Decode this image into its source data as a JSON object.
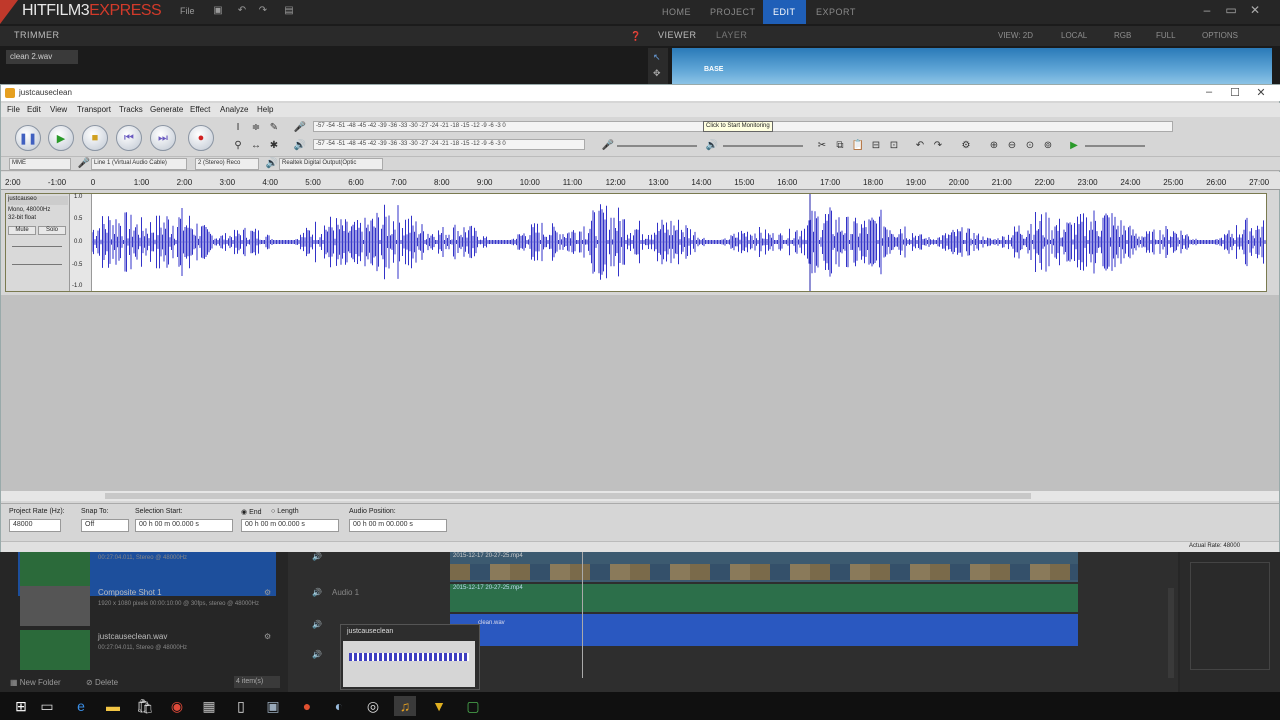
{
  "hitfilm": {
    "logo_main": "HITFILM3",
    "logo_accent": "EXPRESS",
    "menu_file": "File",
    "nav": [
      "HOME",
      "PROJECT",
      "EDIT",
      "EXPORT"
    ],
    "nav_active": "EDIT",
    "trimmer_tab": "TRIMMER",
    "trimmer_file": "clean 2.wav",
    "viewer_tab": "VIEWER",
    "layer_tab": "LAYER",
    "viewer_options": [
      "VIEW: 2D",
      "LOCAL",
      "RGB",
      "FULL",
      "OPTIONS"
    ],
    "viewer_preview_text": "BASE",
    "media": [
      {
        "name": "",
        "desc": "00:27:04.011, Stereo @ 48000Hz"
      },
      {
        "name": "Composite Shot 1",
        "desc": "1920 x 1080 pixels\n00:00:10:00 @ 30fps, stereo @ 48000Hz"
      },
      {
        "name": "justcauseclean.wav",
        "desc": "00:27:04.011, Stereo @ 48000Hz"
      }
    ],
    "new_folder": "New Folder",
    "delete": "Delete",
    "items_count": "4 item(s)",
    "timeline_clip_labels": [
      "2015-12-17 20-27-25.mp4",
      "2015-12-17 20-27-25.mp4",
      "clean.wav"
    ],
    "audio_track_label": "Audio 1",
    "thumb_title": "justcauseclean"
  },
  "audacity": {
    "title": "justcauseclean",
    "menu": [
      "File",
      "Edit",
      "View",
      "Transport",
      "Tracks",
      "Generate",
      "Effect",
      "Analyze",
      "Help"
    ],
    "meter_record_text": "-57 -54 -51 -48 -45 -42 -39 -36 -33 -30 -27 -24 -21 -18 -15 -12 -9 -6 -3 0",
    "meter_tooltip": "Click to Start Monitoring",
    "meter_play_text": "-57 -54 -51 -48 -45 -42 -39 -36 -33 -30 -27 -24 -21 -18 -15 -12 -9 -6 -3 0",
    "host": "MME",
    "rec_device": "Line 1 (Virtual Audio Cable)",
    "channels": "2 (Stereo) Reco",
    "play_device": "Realtek Digital Output(Optic",
    "ruler": [
      "2:00",
      "-1:00",
      "0",
      "1:00",
      "2:00",
      "3:00",
      "4:00",
      "5:00",
      "6:00",
      "7:00",
      "8:00",
      "9:00",
      "10:00",
      "11:00",
      "12:00",
      "13:00",
      "14:00",
      "15:00",
      "16:00",
      "17:00",
      "18:00",
      "19:00",
      "20:00",
      "21:00",
      "22:00",
      "23:00",
      "24:00",
      "25:00",
      "26:00",
      "27:00"
    ],
    "track_name": "justcauseo",
    "track_info": [
      "Mono, 48000Hz",
      "32-bit float"
    ],
    "mute": "Mute",
    "solo": "Solo",
    "scale": [
      "1.0",
      "0.5",
      "0.0",
      "-0.5",
      "-1.0"
    ],
    "project_rate_label": "Project Rate (Hz):",
    "project_rate": "48000",
    "snap_label": "Snap To:",
    "snap_value": "Off",
    "selection_start_label": "Selection Start:",
    "end_label": "End",
    "length_label": "Length",
    "audio_position_label": "Audio Position:",
    "time_zero": "00 h 00 m 00.000 s",
    "status_right": "Actual Rate: 48000"
  },
  "colors": {
    "waveform": "#3232c8",
    "hitfilm_active": "#1f5fb8",
    "hitfilm_accent_red": "#d23a2a"
  }
}
